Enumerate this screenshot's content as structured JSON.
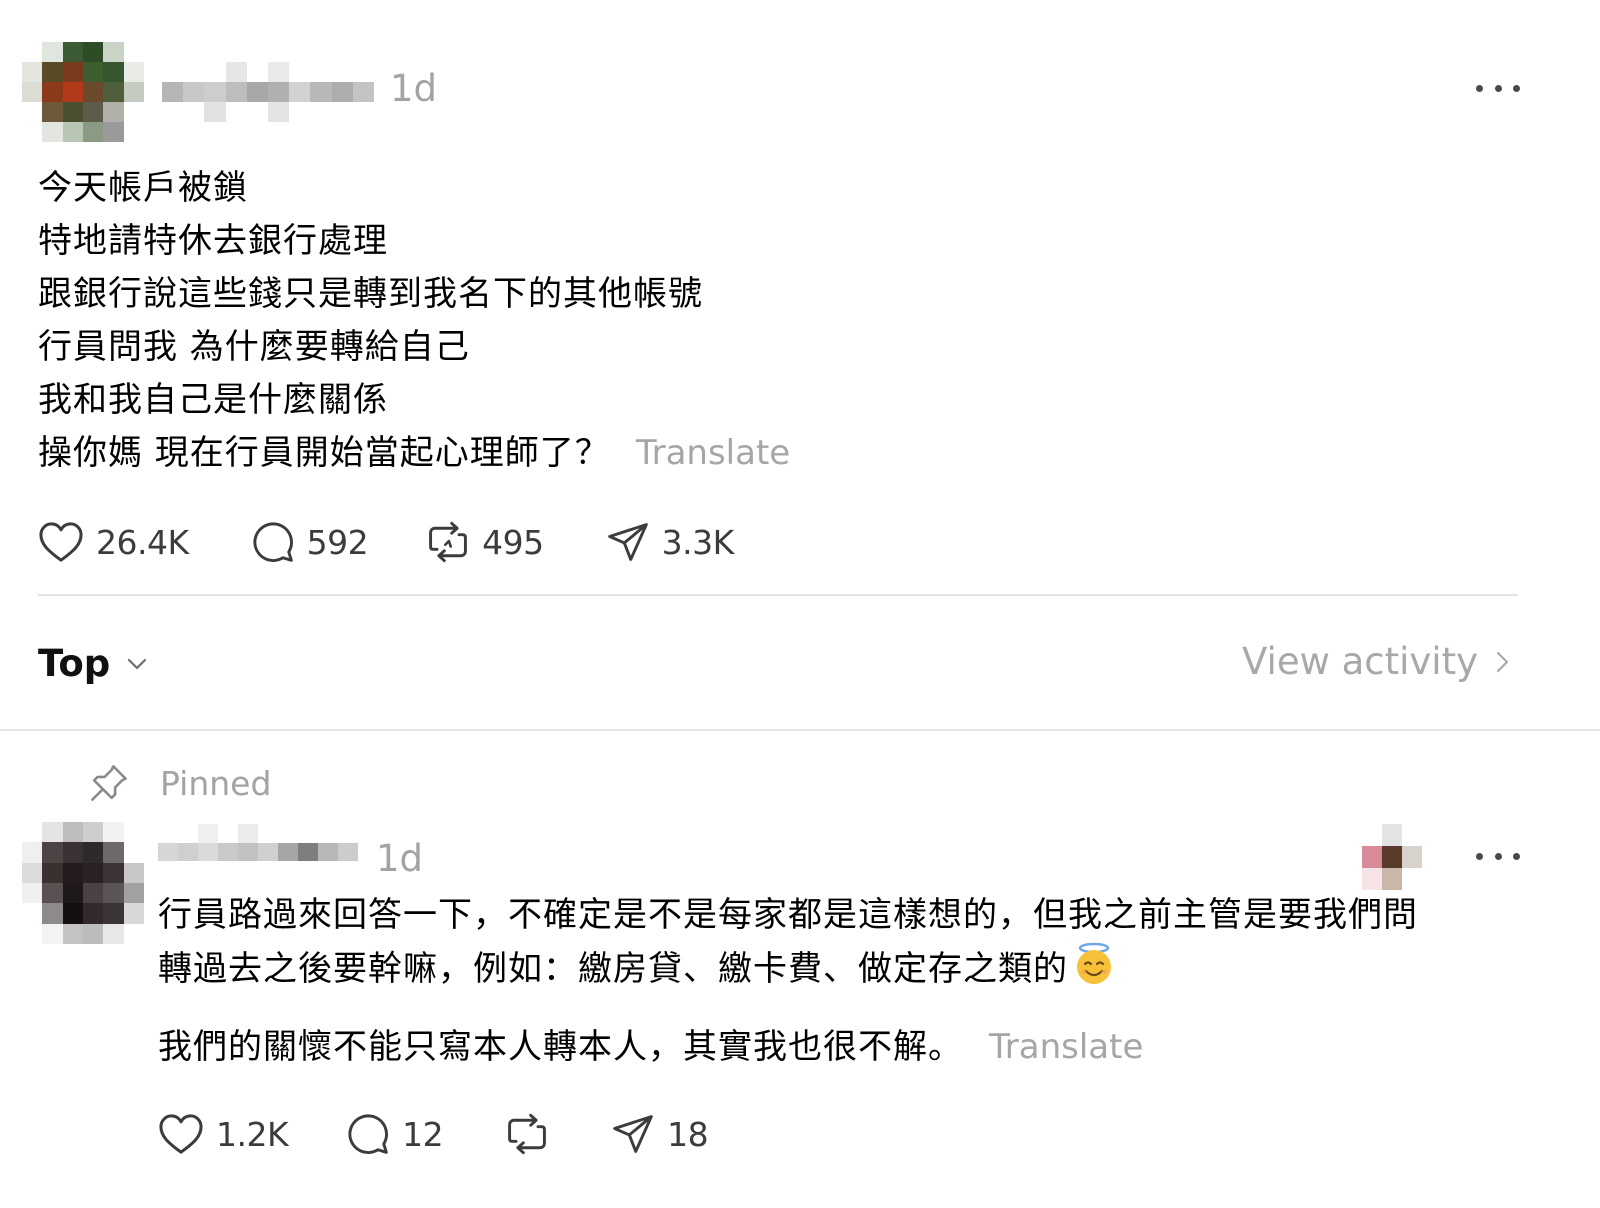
{
  "post": {
    "time": "1d",
    "lines": [
      "今天帳戶被鎖",
      "特地請特休去銀行處理",
      "跟銀行說這些錢只是轉到我名下的其他帳號",
      "行員問我 為什麼要轉給自己",
      "我和我自己是什麼關係",
      "操你媽 現在行員開始當起心理師了？"
    ],
    "translate_label": "Translate",
    "stats": {
      "likes": "26.4K",
      "comments": "592",
      "reposts": "495",
      "shares": "3.3K"
    }
  },
  "sort": {
    "label": "Top",
    "icon": "chevron-down-icon"
  },
  "activity": {
    "label": "View activity",
    "icon": "chevron-right-icon"
  },
  "comment": {
    "pinned_label": "Pinned",
    "time": "1d",
    "paragraph1_lines": [
      "行員路過來回答一下，不確定是不是每家都是這樣想的，但我之前主管是要我們問",
      "轉過去之後要幹嘛，例如：繳房貸、繳卡費、做定存之類的"
    ],
    "emoji": "smiling-face-with-halo",
    "paragraph2": "我們的關懷不能只寫本人轉本人，其實我也很不解。",
    "translate_label": "Translate",
    "stats": {
      "likes": "1.2K",
      "comments": "12",
      "shares": "18"
    }
  },
  "colors": {
    "muted_text": "#a3a3a3",
    "divider": "#e4e4e4",
    "icon": "#3c3c3c"
  }
}
